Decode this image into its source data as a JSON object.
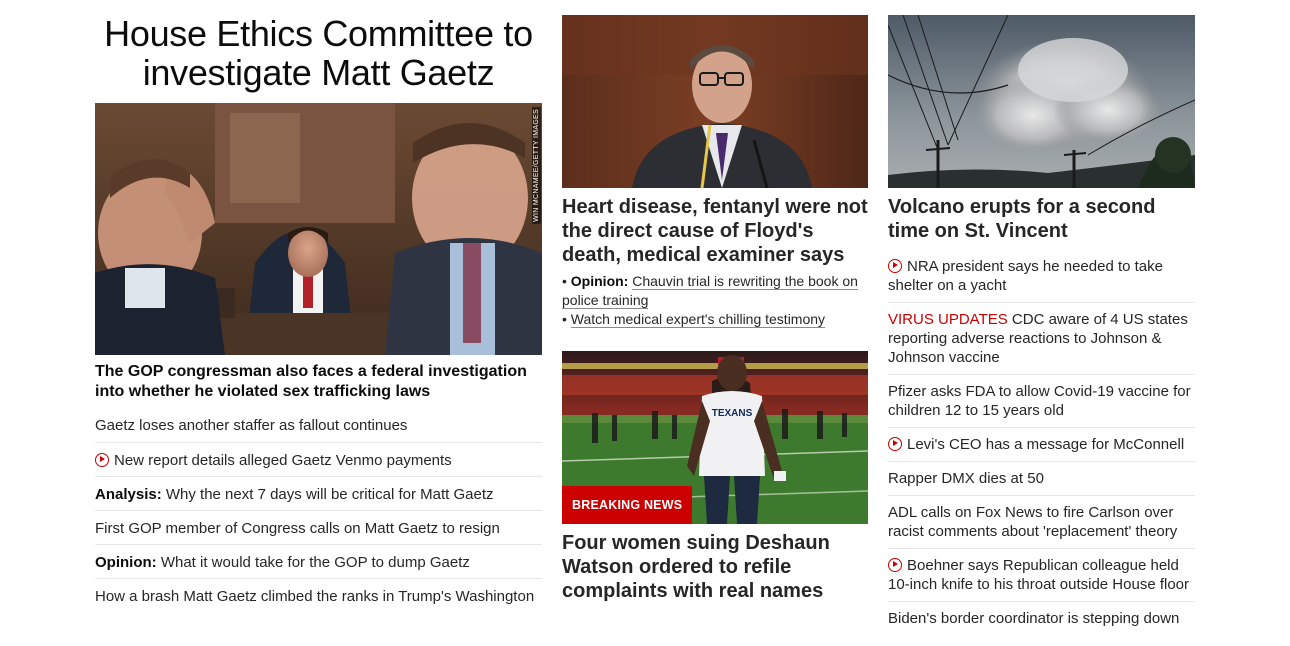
{
  "lead": {
    "headline": "House Ethics Committee to investigate Matt Gaetz",
    "image_credit": "WIN MCNAMEE/GETTY IMAGES",
    "subhead": "The GOP congressman also faces a federal investigation into whether he violated sex trafficking laws",
    "items": [
      {
        "kicker": "",
        "text": "Gaetz loses another staffer as fallout continues",
        "video": false
      },
      {
        "kicker": "",
        "text": "New report details alleged Gaetz Venmo payments",
        "video": true
      },
      {
        "kicker": "Analysis:",
        "text": "Why the next 7 days will be critical for Matt Gaetz",
        "video": false
      },
      {
        "kicker": "",
        "text": "First GOP member of Congress calls on Matt Gaetz to resign",
        "video": false
      },
      {
        "kicker": "Opinion:",
        "text": "What it would take for the GOP to dump Gaetz",
        "video": false
      },
      {
        "kicker": "",
        "text": "How a brash Matt Gaetz climbed the ranks in Trump's Washington",
        "video": false
      }
    ]
  },
  "middle": {
    "floyd_headline": "Heart disease, fentanyl were not the direct cause of Floyd's death, medical examiner says",
    "bullet1_kicker": "Opinion:",
    "bullet1_text": "Chauvin trial is rewriting the book on police training",
    "bullet2_text": "Watch medical expert's chilling testimony",
    "breaking_label": "BREAKING NEWS",
    "jersey_text": "TEXANS",
    "watson_headline": "Four women suing Deshaun Watson ordered to refile complaints with real names"
  },
  "right": {
    "volcano_headline": "Volcano erupts for a second time on St. Vincent",
    "items": [
      {
        "kicker": "",
        "text": "NRA president says he needed to take shelter on a yacht",
        "video": true
      },
      {
        "kicker": "VIRUS UPDATES",
        "text": "CDC aware of 4 US states reporting adverse reactions to Johnson & Johnson vaccine",
        "video": false
      },
      {
        "kicker": "",
        "text": "Pfizer asks FDA to allow Covid-19 vaccine for children 12 to 15 years old",
        "video": false
      },
      {
        "kicker": "",
        "text": "Levi's CEO has a message for McConnell",
        "video": true
      },
      {
        "kicker": "",
        "text": "Rapper DMX dies at 50",
        "video": false
      },
      {
        "kicker": "",
        "text": "ADL calls on Fox News to fire Carlson over racist comments about 'replacement' theory",
        "video": false
      },
      {
        "kicker": "",
        "text": "Boehner says Republican colleague held 10-inch knife to his throat outside House floor",
        "video": true
      },
      {
        "kicker": "",
        "text": "Biden's border coordinator is stepping down",
        "video": false
      }
    ]
  },
  "colors": {
    "accent_red": "#cc0000",
    "text": "#262626",
    "divider": "#e6e6e6"
  },
  "icons": {
    "video": "play-circle-icon"
  }
}
